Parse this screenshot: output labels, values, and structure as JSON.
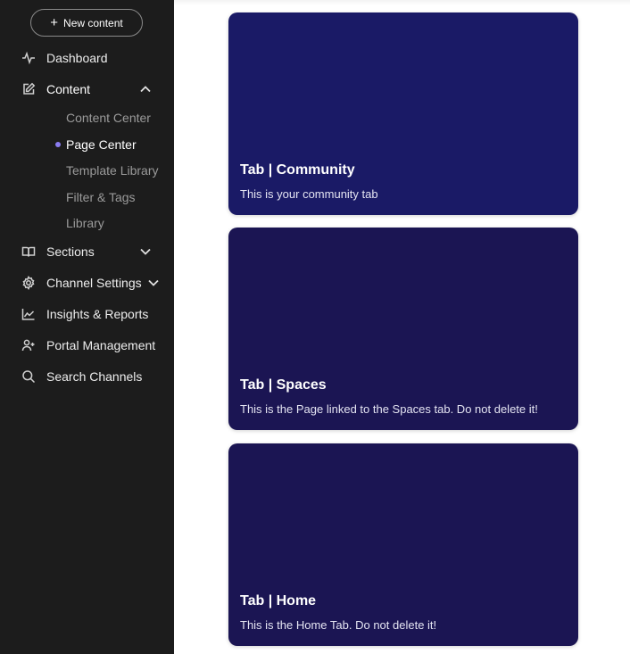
{
  "sidebar": {
    "new_content_label": "New content",
    "items": {
      "dashboard": {
        "label": "Dashboard",
        "icon": "activity-icon"
      },
      "content": {
        "label": "Content",
        "icon": "edit-icon"
      },
      "sections": {
        "label": "Sections",
        "icon": "book-icon"
      },
      "channel_settings": {
        "label": "Channel Settings",
        "icon": "gear-icon"
      },
      "insights": {
        "label": "Insights & Reports",
        "icon": "chart-icon"
      },
      "portal": {
        "label": "Portal Management",
        "icon": "user-plus-icon"
      },
      "search": {
        "label": "Search Channels",
        "icon": "search-icon"
      }
    },
    "content_sub": [
      {
        "label": "Content Center"
      },
      {
        "label": "Page Center"
      },
      {
        "label": "Template Library"
      },
      {
        "label": "Filter & Tags"
      },
      {
        "label": "Library"
      }
    ],
    "active_sub_color": "#8a7cf0"
  },
  "cards": [
    {
      "title": "Tab | Community",
      "description": "This is your community tab",
      "color": "#1a1a66"
    },
    {
      "title": "Tab | Spaces",
      "description": "This is the Page linked to the Spaces tab. Do not delete it!",
      "color": "#1b1553"
    },
    {
      "title": "Tab | Home",
      "description": "This is the Home Tab. Do not delete it!",
      "color": "#1b1553"
    }
  ]
}
